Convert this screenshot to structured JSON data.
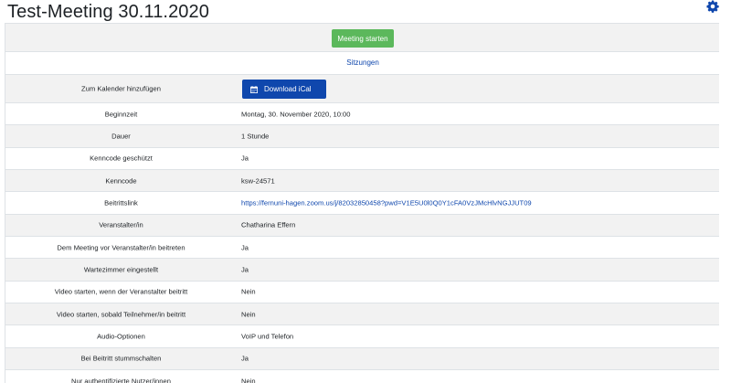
{
  "page": {
    "title": "Test-Meeting 30.11.2020"
  },
  "actions": {
    "start_meeting": "Meeting starten",
    "sessions": "Sitzungen",
    "download_ical": "Download iCal"
  },
  "details": {
    "calendar_label": "Zum Kalender hinzufügen",
    "rows": [
      {
        "label": "Beginnzeit",
        "value": "Montag, 30. November 2020, 10:00"
      },
      {
        "label": "Dauer",
        "value": "1 Stunde"
      },
      {
        "label": "Kenncode geschützt",
        "value": "Ja"
      },
      {
        "label": "Kenncode",
        "value": "ksw-24571"
      },
      {
        "label": "Beitrittslink",
        "value": "https://fernuni-hagen.zoom.us/j/82032850458?pwd=V1E5U0l0Q0Y1cFA0VzJMcHlvNGJJUT09"
      },
      {
        "label": "Veranstalter/in",
        "value": "Chatharina Effern"
      },
      {
        "label": "Dem Meeting vor Veranstalter/in beitreten",
        "value": "Ja"
      },
      {
        "label": "Wartezimmer eingestellt",
        "value": "Ja"
      },
      {
        "label": "Video starten, wenn der Veranstalter beitritt",
        "value": "Nein"
      },
      {
        "label": "Video starten, sobald Teilnehmer/in beitritt",
        "value": "Nein"
      },
      {
        "label": "Audio-Optionen",
        "value": "VoIP und Telefon"
      },
      {
        "label": "Bei Beitritt stummschalten",
        "value": "Ja"
      },
      {
        "label": "Nur authentifizierte Nutzer/innen",
        "value": "Nein"
      }
    ]
  },
  "icons": {
    "settings": "gear-icon",
    "calendar": "calendar-icon"
  },
  "colors": {
    "start_button": "#5cb85c",
    "primary_button": "#0f47ad",
    "link": "#0f47ad",
    "row_stripe": "#f2f2f2"
  }
}
